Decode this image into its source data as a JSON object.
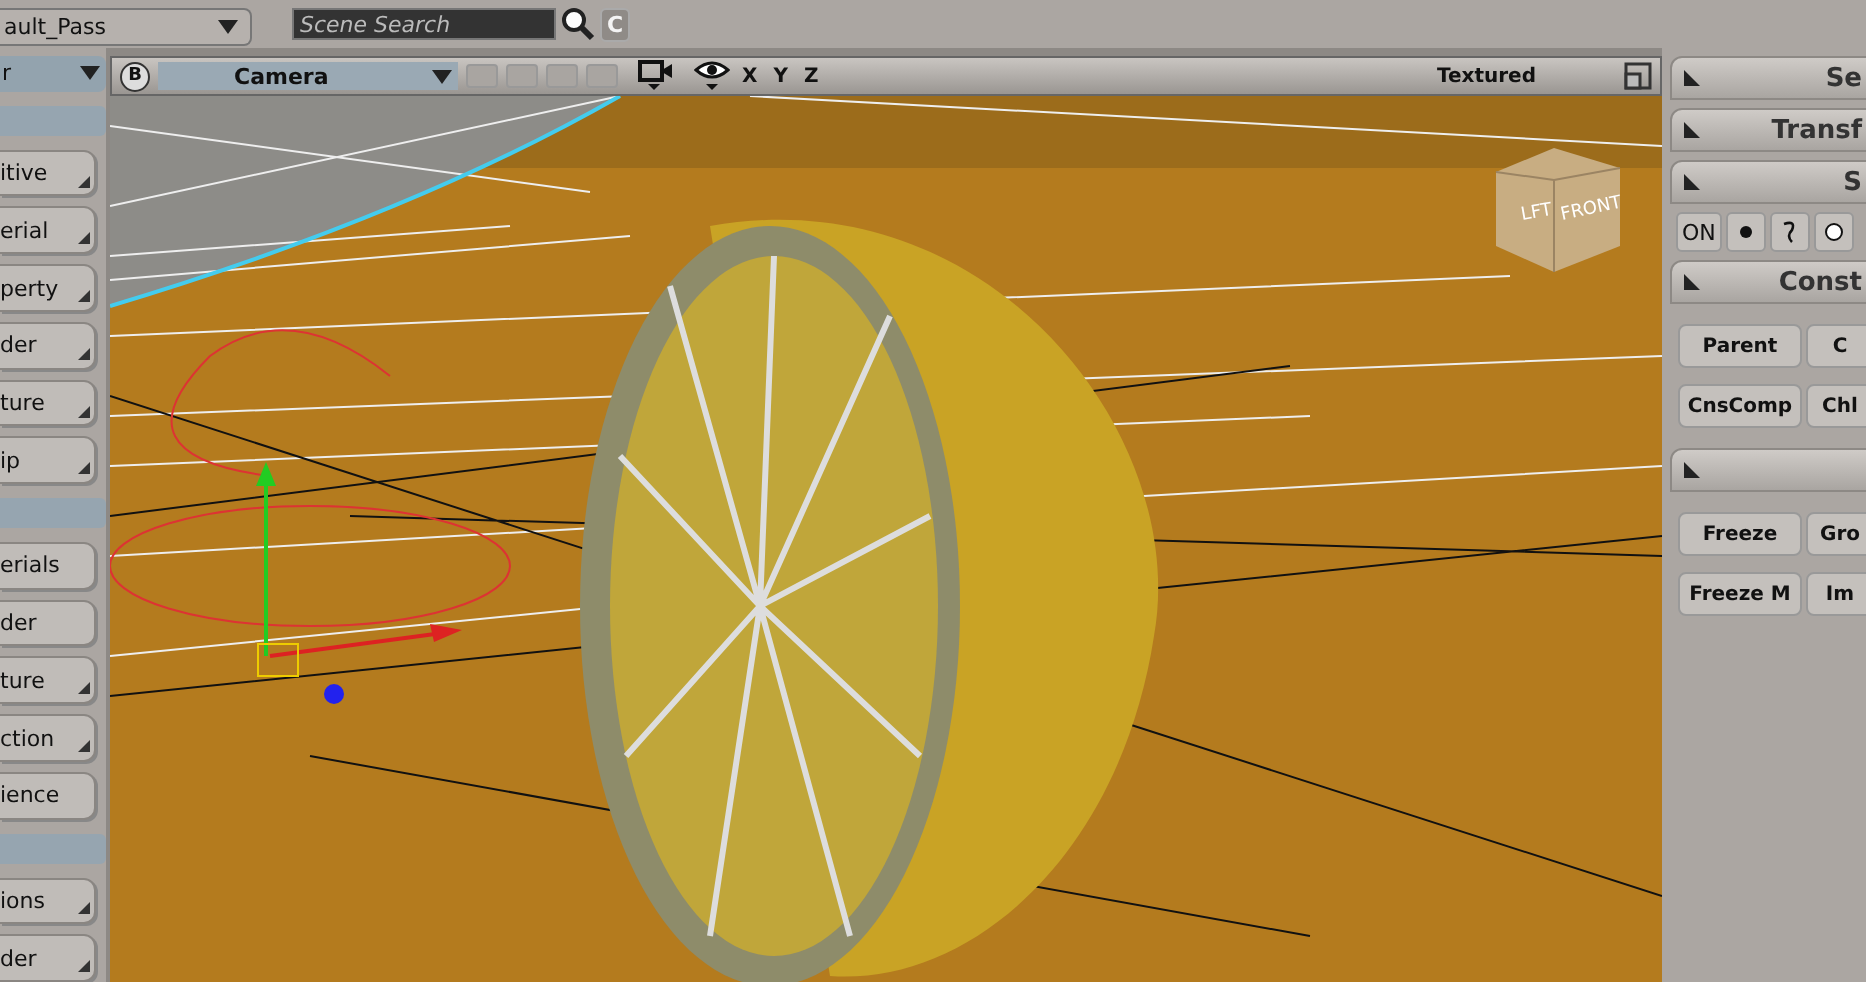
{
  "top_bar": {
    "pass_dropdown": "ault_Pass",
    "search": {
      "placeholder": "Scene Search"
    },
    "clear_button": "C"
  },
  "left_panel": {
    "dropdown": "r",
    "groups": [
      {
        "items": [
          {
            "label": "itive",
            "menu": true
          },
          {
            "label": "erial",
            "menu": true
          },
          {
            "label": "perty",
            "menu": true
          },
          {
            "label": "der",
            "menu": true
          },
          {
            "label": "ture",
            "menu": true
          },
          {
            "label": "ip",
            "menu": true
          }
        ]
      },
      {
        "items": [
          {
            "label": "erials",
            "menu": false
          },
          {
            "label": "der",
            "menu": false
          },
          {
            "label": "ture",
            "menu": true
          },
          {
            "label": "ction",
            "menu": true
          },
          {
            "label": "ience",
            "menu": false
          }
        ]
      },
      {
        "items": [
          {
            "label": "ions",
            "menu": true
          },
          {
            "label": "der",
            "menu": true
          }
        ]
      }
    ]
  },
  "viewport": {
    "b_button": "B",
    "camera": "Camera",
    "axes": [
      "X",
      "Y",
      "Z"
    ],
    "display_mode": "Textured",
    "cube_labels": [
      "LFT",
      "FRONT"
    ]
  },
  "right_panel": {
    "sections": [
      {
        "title": "Se"
      },
      {
        "title": "Transf"
      },
      {
        "title": "S",
        "tools": {
          "on_label": "ON"
        }
      },
      {
        "title": "Const",
        "buttons": [
          "Parent",
          "C",
          "CnsComp",
          "Chl"
        ]
      },
      {
        "buttons": [
          "Freeze",
          "Gro",
          "Freeze M",
          "Im"
        ]
      }
    ]
  }
}
